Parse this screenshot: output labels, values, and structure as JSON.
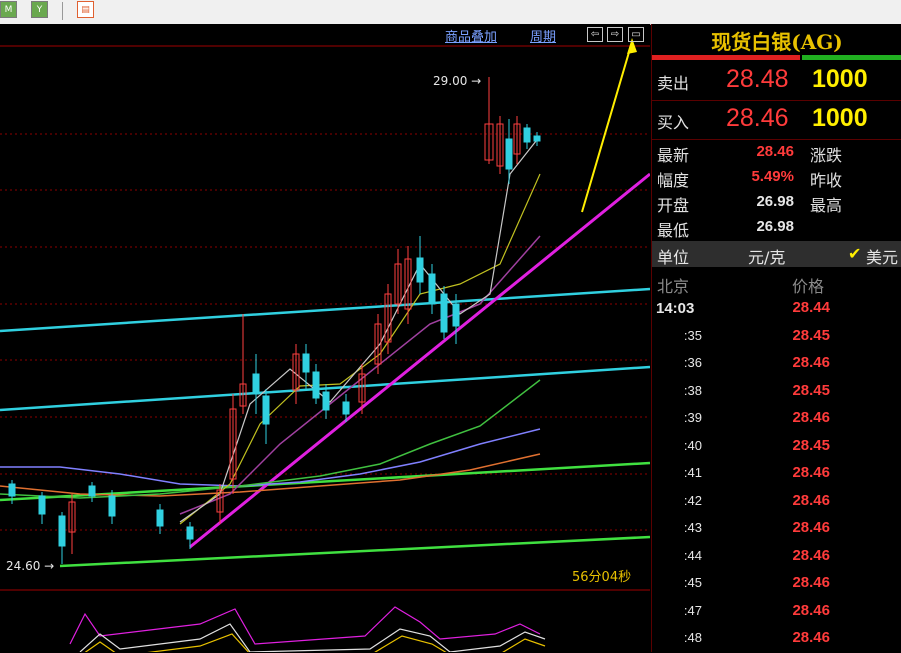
{
  "toolbar": {
    "buttons": [
      "sub-chart-icon",
      "filter-icon",
      "calendar-icon"
    ]
  },
  "chart": {
    "links": [
      "商品叠加",
      "周期"
    ],
    "high_label": "29.00",
    "low_label": "24.60",
    "countdown": "56分04秒"
  },
  "quote": {
    "title": "现货白银(AG)",
    "sell": {
      "label": "卖出",
      "price": "28.48",
      "volume": "1000"
    },
    "buy": {
      "label": "买入",
      "price": "28.46",
      "volume": "1000"
    },
    "stats": [
      {
        "label": "最新",
        "value": "28.46",
        "label2": "涨跌",
        "color": "#ff3b3b"
      },
      {
        "label": "幅度",
        "value": "5.49%",
        "label2": "昨收",
        "color": "#ff3b3b"
      },
      {
        "label": "开盘",
        "value": "26.98",
        "label2": "最高",
        "color": "#e6e6e6"
      },
      {
        "label": "最低",
        "value": "26.98",
        "label2": "",
        "color": "#e6e6e6"
      }
    ],
    "unit": {
      "label": "单位",
      "value": "元/克",
      "check": "✔",
      "currency": "美元"
    },
    "ticks_header": {
      "city": "北京",
      "price": "价格"
    },
    "ticks": [
      {
        "time": "14:03",
        "price": "28.44"
      },
      {
        "time": ":35",
        "price": "28.45"
      },
      {
        "time": ":36",
        "price": "28.46"
      },
      {
        "time": ":38",
        "price": "28.45"
      },
      {
        "time": ":39",
        "price": "28.46"
      },
      {
        "time": ":40",
        "price": "28.45"
      },
      {
        "time": ":41",
        "price": "28.46"
      },
      {
        "time": ":42",
        "price": "28.46"
      },
      {
        "time": ":43",
        "price": "28.46"
      },
      {
        "time": ":44",
        "price": "28.46"
      },
      {
        "time": ":45",
        "price": "28.46"
      },
      {
        "time": ":47",
        "price": "28.46"
      },
      {
        "time": ":48",
        "price": "28.46"
      }
    ]
  }
}
